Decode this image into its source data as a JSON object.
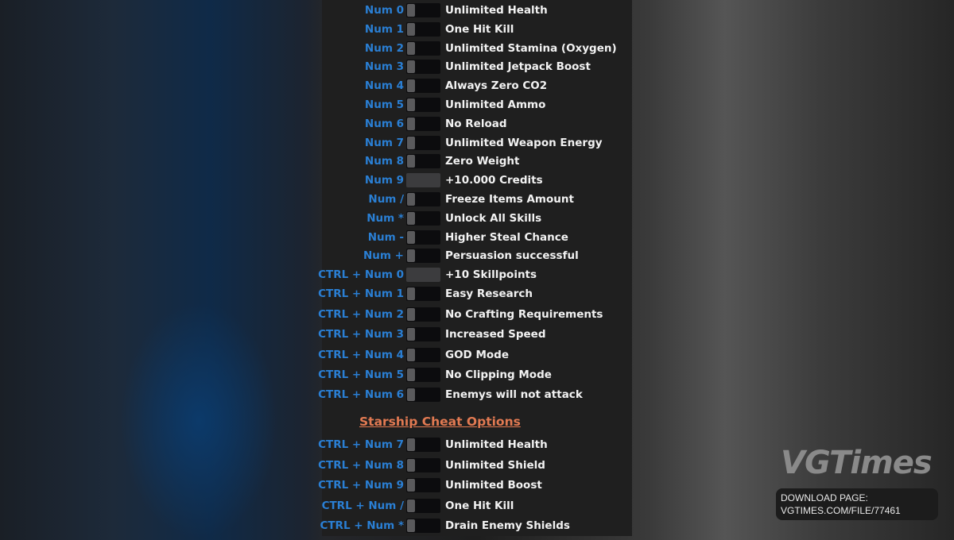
{
  "player_cheats": [
    {
      "key": "Num 0",
      "label": "Unlimited Health",
      "control": "toggle"
    },
    {
      "key": "Num 1",
      "label": "One Hit Kill",
      "control": "toggle"
    },
    {
      "key": "Num 2",
      "label": "Unlimited Stamina (Oxygen)",
      "control": "toggle"
    },
    {
      "key": "Num 3",
      "label": "Unlimited Jetpack Boost",
      "control": "toggle"
    },
    {
      "key": "Num 4",
      "label": "Always Zero CO2",
      "control": "toggle"
    },
    {
      "key": "Num 5",
      "label": "Unlimited Ammo",
      "control": "toggle"
    },
    {
      "key": "Num 6",
      "label": "No Reload",
      "control": "toggle"
    },
    {
      "key": "Num 7",
      "label": "Unlimited Weapon Energy",
      "control": "toggle"
    },
    {
      "key": "Num 8",
      "label": "Zero Weight",
      "control": "toggle"
    },
    {
      "key": "Num 9",
      "label": "+10.000 Credits",
      "control": "button"
    },
    {
      "key": "Num /",
      "label": "Freeze Items Amount",
      "control": "toggle"
    },
    {
      "key": "Num *",
      "label": "Unlock All Skills",
      "control": "toggle"
    },
    {
      "key": "Num -",
      "label": "Higher Steal Chance",
      "control": "toggle"
    },
    {
      "key": "Num +",
      "label": "Persuasion successful",
      "control": "toggle"
    },
    {
      "key": "CTRL + Num 0",
      "label": "+10 Skillpoints",
      "control": "button"
    },
    {
      "key": "CTRL + Num 1",
      "label": "Easy Research",
      "control": "toggle"
    },
    {
      "key": "CTRL + Num 2",
      "label": "No Crafting Requirements",
      "control": "toggle"
    },
    {
      "key": "CTRL + Num 3",
      "label": "Increased Speed",
      "control": "toggle"
    },
    {
      "key": "CTRL + Num 4",
      "label": "GOD Mode",
      "control": "toggle"
    },
    {
      "key": "CTRL + Num 5",
      "label": "No Clipping Mode",
      "control": "toggle"
    },
    {
      "key": "CTRL + Num 6",
      "label": "Enemys will not attack",
      "control": "toggle"
    }
  ],
  "starship_section_title": "Starship Cheat Options",
  "starship_cheats": [
    {
      "key": "CTRL + Num 7",
      "label": "Unlimited Health",
      "control": "toggle"
    },
    {
      "key": "CTRL + Num 8",
      "label": "Unlimited Shield",
      "control": "toggle"
    },
    {
      "key": "CTRL + Num 9",
      "label": "Unlimited Boost",
      "control": "toggle"
    },
    {
      "key": "CTRL + Num /",
      "label": "One Hit Kill",
      "control": "toggle"
    },
    {
      "key": "CTRL + Num *",
      "label": "Drain Enemy Shields",
      "control": "toggle"
    }
  ],
  "watermark": {
    "logo": "VGTimes",
    "download_line1": "DOWNLOAD PAGE:",
    "download_line2": "VGTIMES.COM/FILE/77461"
  },
  "colors": {
    "hotkey": "#2a7fd4",
    "section": "#e27a52",
    "label": "#f2f2f2",
    "panel": "#1f1f1f"
  }
}
